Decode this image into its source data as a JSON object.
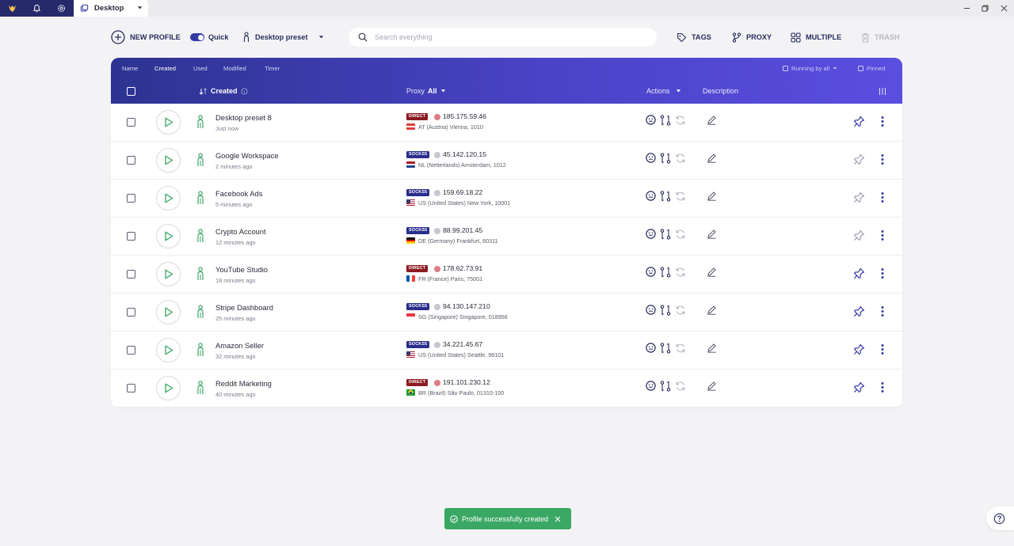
{
  "titlebar": {
    "tab_label": "Desktop",
    "icons": [
      "logo-icon",
      "bell-icon",
      "settings-icon"
    ]
  },
  "toolbar": {
    "new_profile": "NEW PROFILE",
    "quick": "Quick",
    "quick_on": true,
    "preset": "Desktop preset",
    "search_placeholder": "Search everything",
    "tags": "TAGS",
    "proxy": "PROXY",
    "multiple": "MULTIPLE",
    "trash": "TRASH"
  },
  "table": {
    "sort_tabs": [
      "Name",
      "Created",
      "Used",
      "Modified",
      "Timer"
    ],
    "active_sort": "Created",
    "running_by_all": "Running by all",
    "pinned": "Pinned",
    "col_created": "Created",
    "col_proxy": "Proxy",
    "col_proxy_filter": "All",
    "col_actions": "Actions",
    "col_description": "Description",
    "rows": [
      {
        "name": "Desktop preset 8",
        "time": "Just now",
        "type": "DIRECT",
        "ip": "185.175.59.46",
        "loc": "AT (Austria) Vienna, 1010",
        "flag": "at",
        "status": "#e07b86",
        "pinned": true
      },
      {
        "name": "Google Workspace",
        "time": "2 minutes ago",
        "type": "SOCKS5",
        "ip": "45.142.120.15",
        "loc": "NL (Netterlands) Amsterdam, 1012",
        "flag": "nl",
        "status": "#c8c9d0",
        "pinned": false
      },
      {
        "name": "Facebook Ads",
        "time": "5 minutes ago",
        "type": "SOCKS5",
        "ip": "159.69.18.22",
        "loc": "US (United States) New York, 10001",
        "flag": "us",
        "status": "#c8c9d0",
        "pinned": false
      },
      {
        "name": "Crypto Account",
        "time": "12 minutes ago",
        "type": "SOCKS5",
        "ip": "88.99.201.45",
        "loc": "DE (Germany) Frankfurt, 60311",
        "flag": "de",
        "status": "#c8c9d0",
        "pinned": false
      },
      {
        "name": "YouTube Studio",
        "time": "18 minutes ago",
        "type": "DIRECT",
        "ip": "178.62.73.91",
        "loc": "FR (France) Paris, 75001",
        "flag": "fr",
        "status": "#e07b86",
        "pinned": true
      },
      {
        "name": "Stripe Dashboard",
        "time": "25 minutes ago",
        "type": "SOCKS5",
        "ip": "94.130.147.210",
        "loc": "SG (Singapore) Singapore, 018956",
        "flag": "sg",
        "status": "#c8c9d0",
        "pinned": true
      },
      {
        "name": "Amazon Seller",
        "time": "32 minutes ago",
        "type": "SOCKS5",
        "ip": "34.221.45.67",
        "loc": "US (United States) Seattle, 98101",
        "flag": "us",
        "status": "#c8c9d0",
        "pinned": true
      },
      {
        "name": "Reddit Marketing",
        "time": "40 minutes ago",
        "type": "DIRECT",
        "ip": "191.101.230.12",
        "loc": "BR (Brazil) São Paulo, 01310-100",
        "flag": "br",
        "status": "#e07b86",
        "pinned": true
      }
    ]
  },
  "toast": {
    "message": "Profile successfully created"
  },
  "colors": {
    "accent": "#3539a5",
    "header_start": "#2d3391",
    "header_end": "#5a4ee0",
    "success": "#3aa864",
    "direct": "#8c1c22",
    "socks": "#2a2e8c",
    "play": "#3aa864"
  }
}
